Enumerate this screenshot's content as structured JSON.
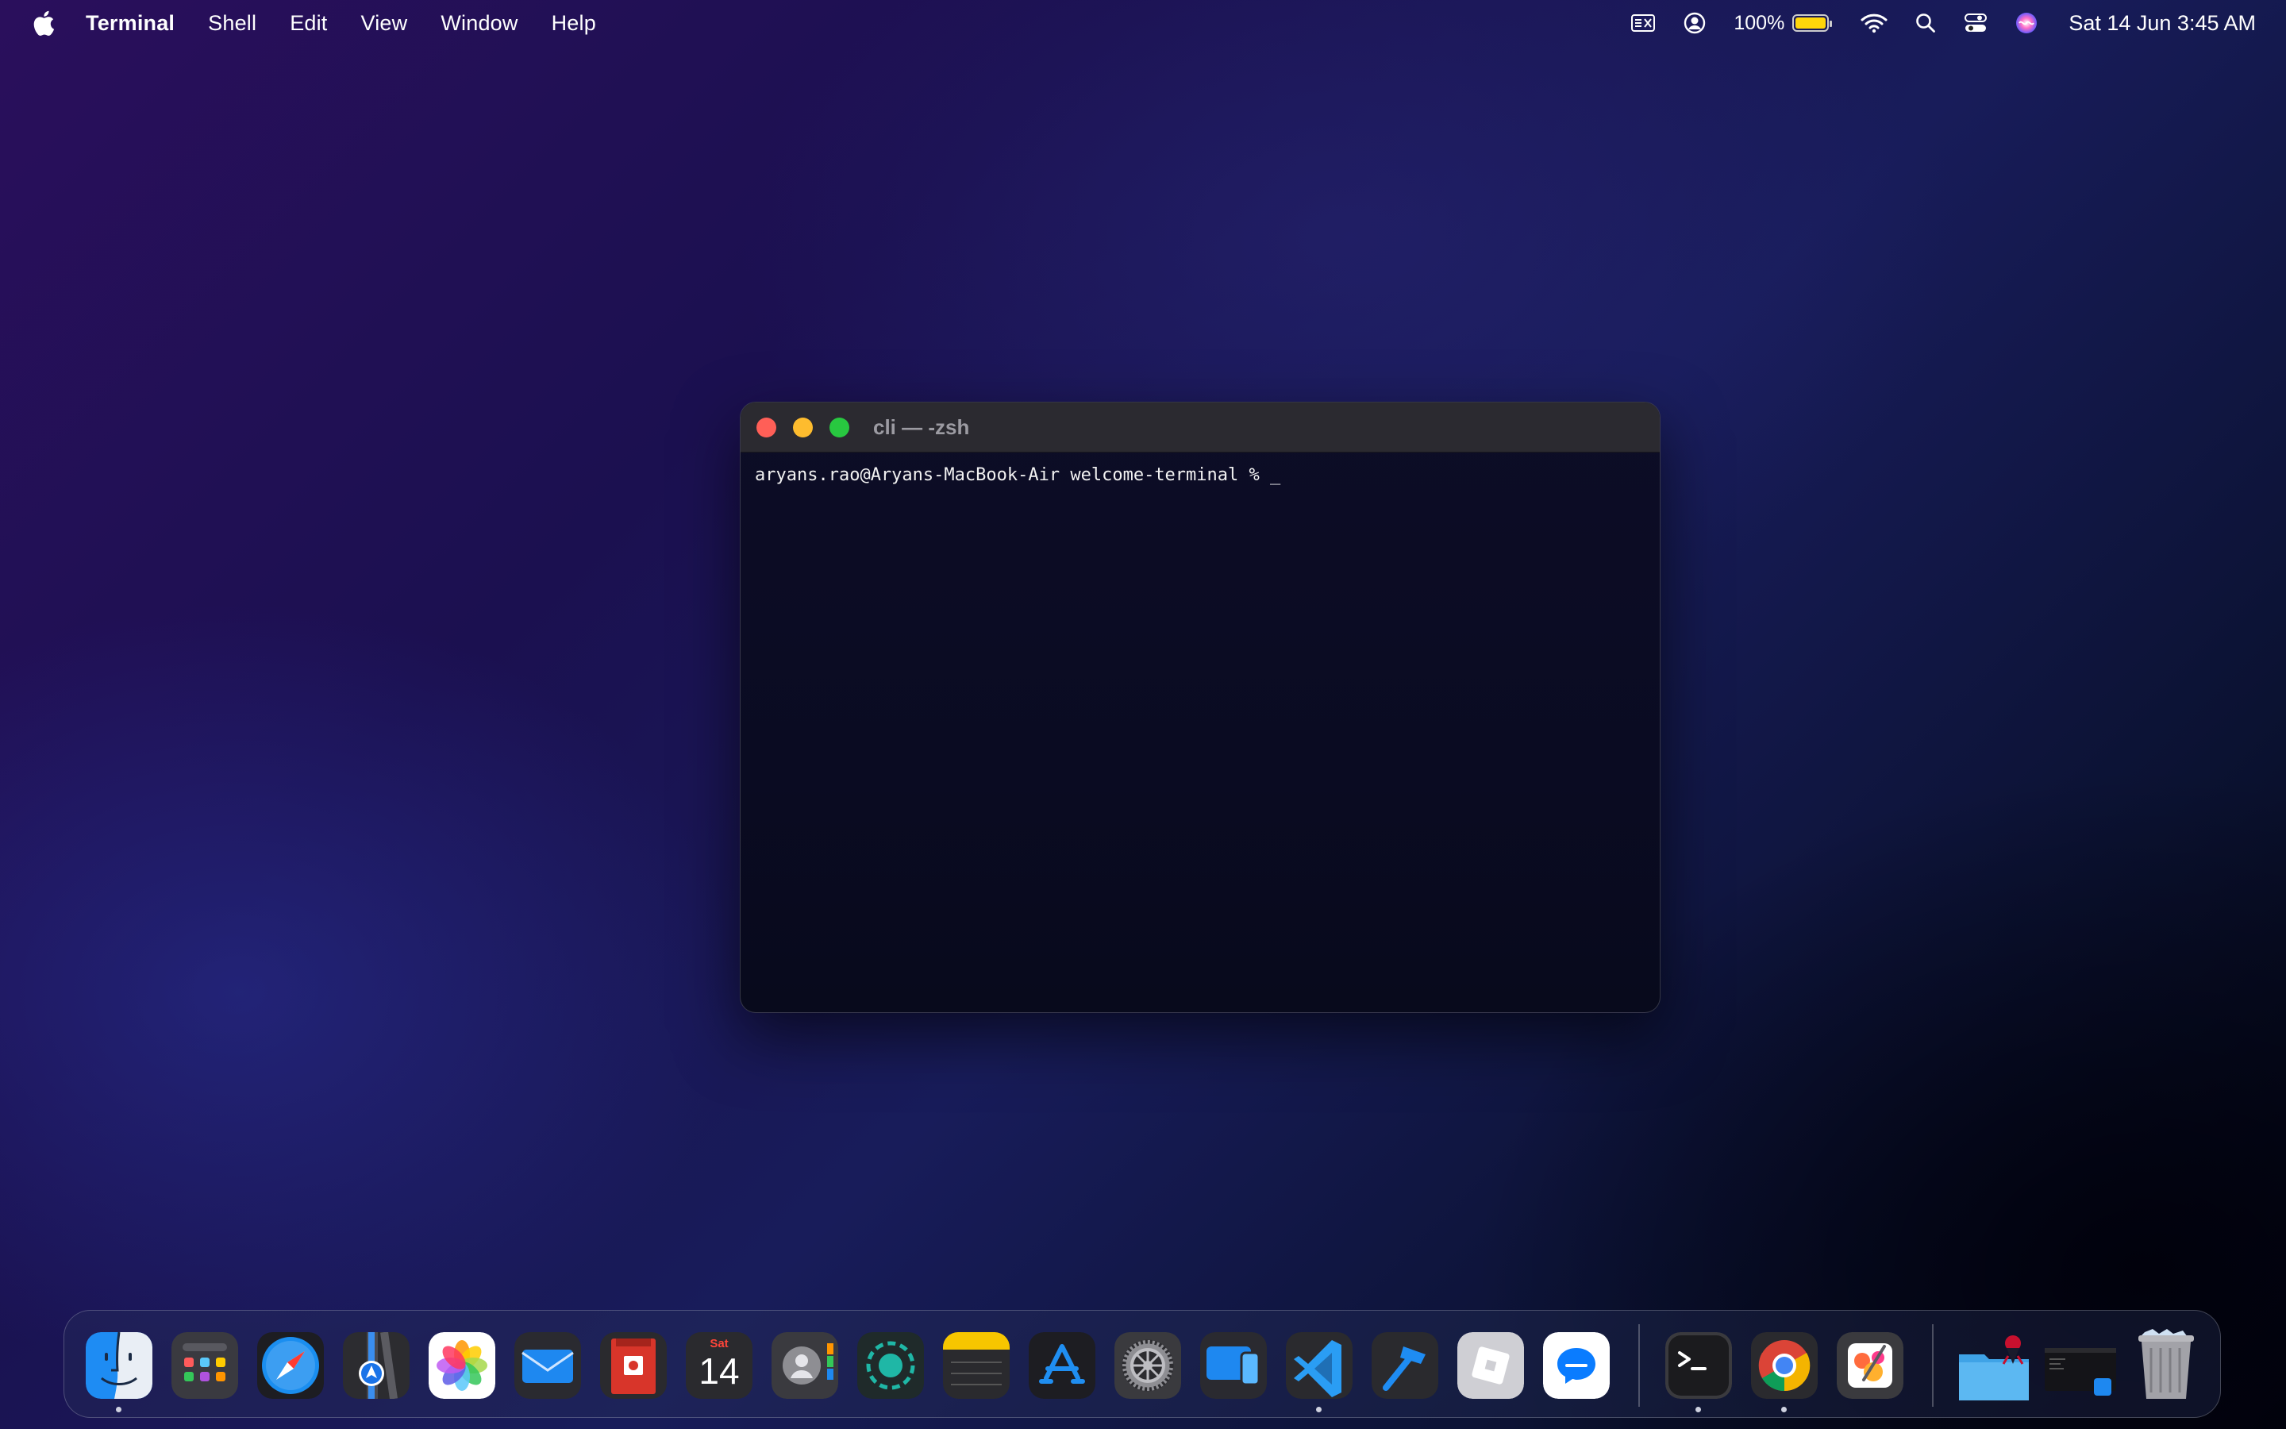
{
  "menubar": {
    "app_name": "Terminal",
    "menus": [
      "Shell",
      "Edit",
      "View",
      "Window",
      "Help"
    ],
    "battery_percent": "100%",
    "battery_level": 1.0,
    "datetime": "Sat 14 Jun  3:45 AM"
  },
  "window": {
    "title": "cli — -zsh",
    "prompt": "aryans.rao@Aryans-MacBook-Air welcome-terminal % _"
  },
  "dock": {
    "calendar_day": "Sat",
    "calendar_date": "14",
    "apps": [
      "finder",
      "launchpad",
      "safari",
      "maps",
      "photos",
      "mail",
      "photo-booth",
      "calendar",
      "contacts",
      "screen-recorder",
      "notes",
      "app-store",
      "system-settings",
      "iphone-mirroring",
      "vscode",
      "xcode",
      "roblox",
      "messenger",
      "terminal",
      "chrome",
      "pixelmator",
      "downloads-folder",
      "recent-window",
      "trash"
    ]
  },
  "colors": {
    "accent_battery": "#ffd60a",
    "close": "#ff5f57",
    "minimize": "#febc2e",
    "maximize": "#28c840"
  }
}
